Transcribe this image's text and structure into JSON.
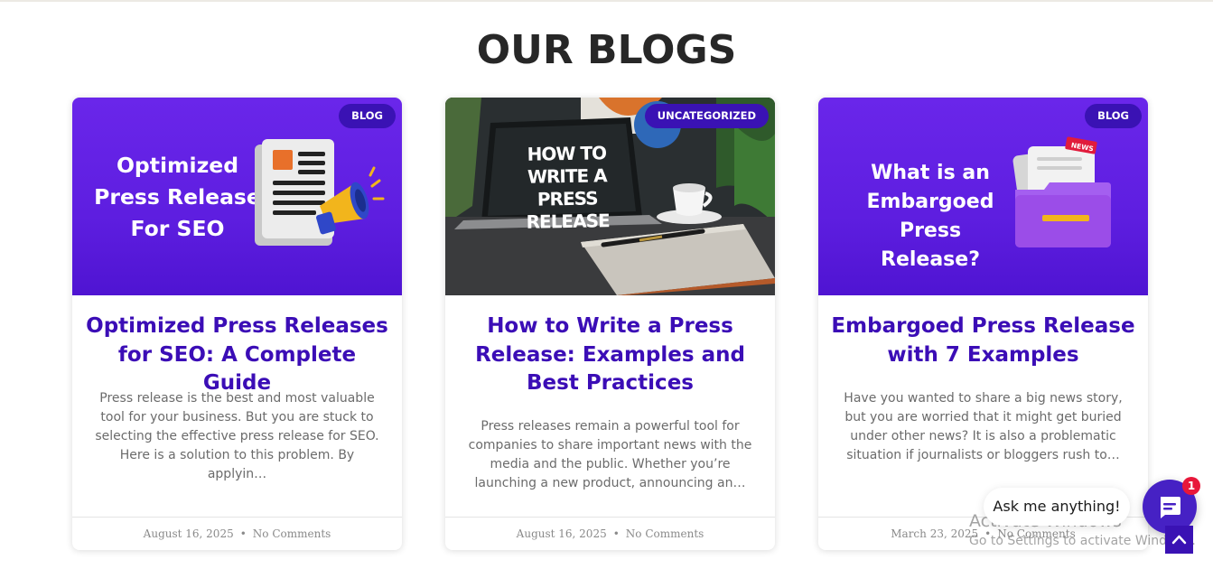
{
  "section": {
    "title": "OUR BLOGS"
  },
  "posts": [
    {
      "category": "BLOG",
      "thumb_lines": [
        "Optimized",
        "Press Release",
        "For SEO"
      ],
      "title": "Optimized Press Releases for SEO: A Complete Guide",
      "excerpt": "Press release is the best and most valuable tool for your business. But you are stuck to selecting the effective press release for SEO. Here is a solution to this problem. By applyin…",
      "date": "August 16, 2025",
      "comments": "No Comments"
    },
    {
      "category": "UNCATEGORIZED",
      "thumb_lines": [
        "HOW TO WRITE A",
        "PRESS RELEASE"
      ],
      "title": "How to Write a Press Release: Examples and Best Practices",
      "excerpt": "Press releases remain a powerful tool for companies to share important news with the media and the public. Whether you’re launching a new product, announcing an…",
      "date": "August 16, 2025",
      "comments": "No Comments"
    },
    {
      "category": "BLOG",
      "thumb_lines": [
        "What is an",
        "Embargoed",
        "Press Release?"
      ],
      "thumb_badge": "NEWS",
      "title": "Embargoed Press Release with 7 Examples",
      "excerpt": "Have you wanted to share a big news story, but you are worried that it might get buried under other news? It is also a problematic situation if journalists or bloggers rush to…",
      "date": "March 23, 2025",
      "comments": "No Comments"
    }
  ],
  "footer_separator": "•",
  "chat": {
    "prompt": "Ask me anything!",
    "unread_count": "1",
    "icon": "chat-icon"
  },
  "scroll_top": {
    "icon": "chevron-up-icon"
  },
  "watermark": {
    "line1": "Activate Windows",
    "line2": "Go to Settings to activate Windows."
  },
  "colors": {
    "accent": "#3b0db6",
    "badge": "#3a12b4",
    "thumb_purple": "#6a26ea",
    "chat": "#4621c4",
    "notify": "#e8173a"
  }
}
